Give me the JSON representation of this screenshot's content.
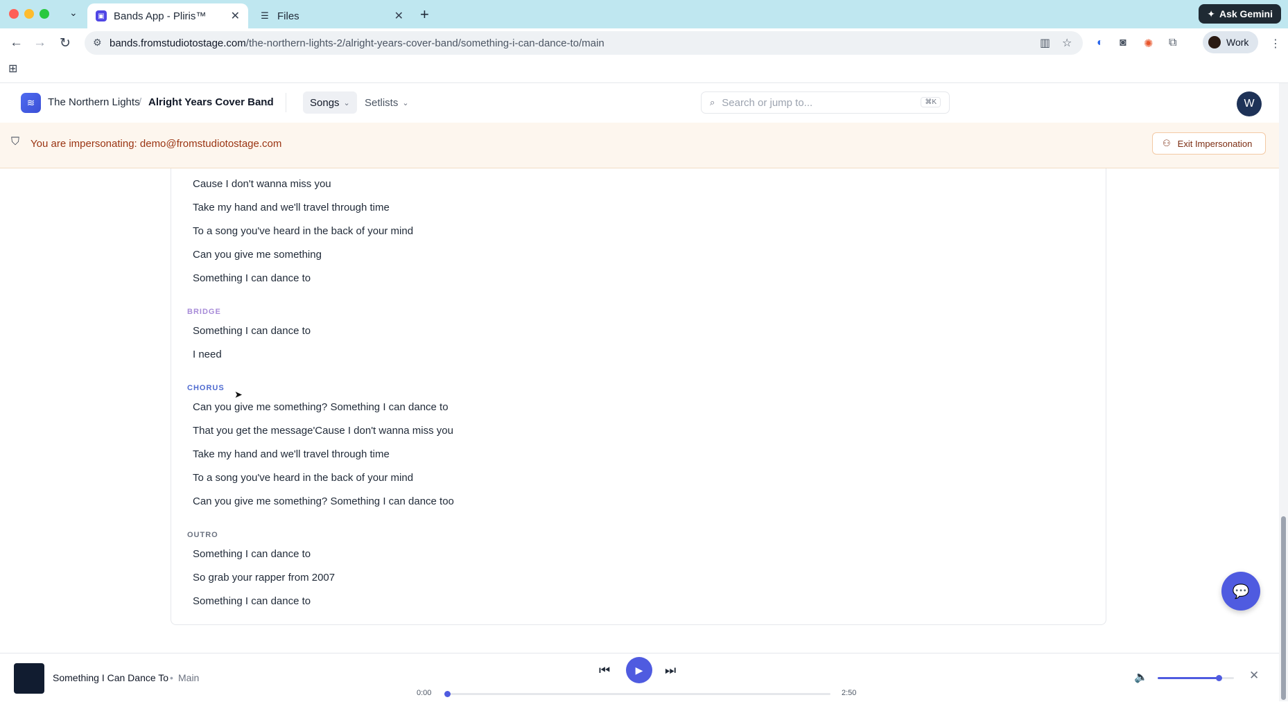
{
  "browser": {
    "tabs": [
      {
        "title": "Bands App - Pliris™",
        "active": true
      },
      {
        "title": "Files",
        "active": false
      }
    ],
    "gemini_label": "Ask Gemini",
    "url_host": "bands.fromstudiotostage.com",
    "url_path": "/the-northern-lights-2/alright-years-cover-band/something-i-can-dance-to/main",
    "profile_label": "Work"
  },
  "header": {
    "org": "The Northern Lights",
    "separator": "/",
    "band": "Alright Years Cover Band",
    "nav": [
      "Songs",
      "Setlists"
    ],
    "search_placeholder": "Search or jump to...",
    "search_shortcut": "⌘K",
    "avatar_initial": "W"
  },
  "impersonation": {
    "text": "You are impersonating: demo@fromstudiotostage.com",
    "exit_label": "Exit Impersonation"
  },
  "lyrics": {
    "intro_lines": [
      "Cause I don't wanna miss you",
      "Take my hand and we'll travel through time",
      "To a song you've heard in the back of your mind",
      "Can you give me something",
      "Something I can dance to"
    ],
    "bridge": {
      "label": "BRIDGE",
      "lines": [
        "Something I can dance to",
        "I need"
      ]
    },
    "chorus": {
      "label": "CHORUS",
      "lines": [
        "Can you give me something? Something I can dance to",
        "That you get the message'Cause I don't wanna miss you",
        "Take my hand and we'll travel through time",
        "To a song you've heard in the back of your mind",
        "Can you give me something? Something I can dance too"
      ]
    },
    "outro": {
      "label": "OUTRO",
      "lines": [
        "Something I can dance to",
        "So grab your rapper from 2007",
        "Something I can dance to"
      ]
    }
  },
  "player": {
    "title": "Something I Can Dance To",
    "separator": "•",
    "version": "Main",
    "current_time": "0:00",
    "duration": "2:50",
    "progress_fraction": 0.0,
    "volume_fraction": 0.8
  },
  "colors": {
    "accent": "#4f5be0",
    "banner_bg": "#fdf6ee",
    "banner_text": "#9a3412",
    "tabbar_bg": "#bfe7f0"
  },
  "icons": {
    "logo": "layers-icon",
    "search": "search-icon",
    "shield": "shield-icon",
    "exit": "user-x-icon",
    "chat": "chat-icon",
    "prev": "skip-back-icon",
    "play": "play-icon",
    "next": "skip-forward-icon",
    "volume": "volume-icon",
    "close": "close-icon"
  }
}
